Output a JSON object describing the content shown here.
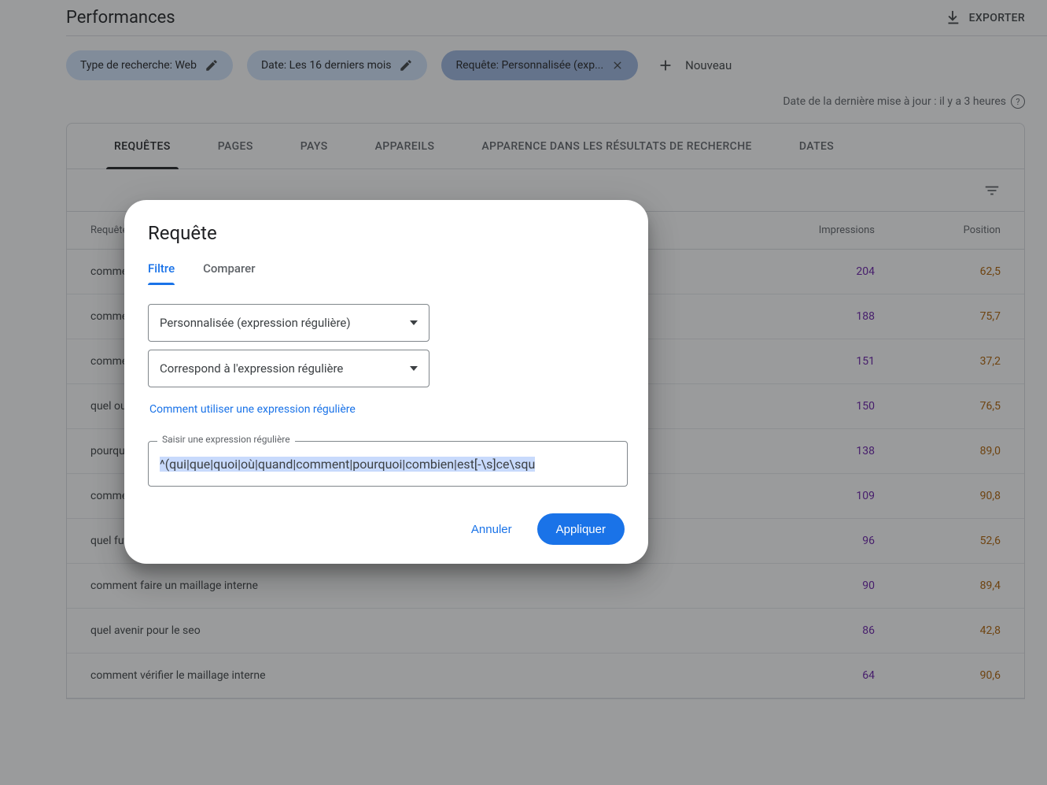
{
  "header": {
    "title": "Performances",
    "export_label": "EXPORTER"
  },
  "chips": {
    "search_type": "Type de recherche: Web",
    "date": "Date: Les 16 derniers mois",
    "query": "Requête: Personnalisée (exp...",
    "new_label": "Nouveau"
  },
  "last_update": "Date de la dernière mise à jour : il y a 3 heures",
  "tabs": {
    "requetes": "REQUÊTES",
    "pages": "PAGES",
    "pays": "PAYS",
    "appareils": "APPAREILS",
    "apparence": "APPARENCE DANS LES RÉSULTATS DE RECHERCHE",
    "dates": "DATES"
  },
  "table": {
    "col_query": "Requêtes",
    "col_impressions": "Impressions",
    "col_position": "Position",
    "rows": [
      {
        "q": "comme",
        "imp": "204",
        "pos": "62,5"
      },
      {
        "q": "comme",
        "imp": "188",
        "pos": "75,7"
      },
      {
        "q": "comme",
        "imp": "151",
        "pos": "37,2"
      },
      {
        "q": "quel ou",
        "imp": "150",
        "pos": "76,5"
      },
      {
        "q": "pourqu",
        "imp": "138",
        "pos": "89,0"
      },
      {
        "q": "comme",
        "imp": "109",
        "pos": "90,8"
      },
      {
        "q": "quel futur pour le seo",
        "imp": "96",
        "pos": "52,6"
      },
      {
        "q": "comment faire un maillage interne",
        "imp": "90",
        "pos": "89,4"
      },
      {
        "q": "quel avenir pour le seo",
        "imp": "86",
        "pos": "42,8"
      },
      {
        "q": "comment vérifier le maillage interne",
        "imp": "64",
        "pos": "90,6"
      }
    ]
  },
  "dialog": {
    "title": "Requête",
    "tab_filter": "Filtre",
    "tab_compare": "Comparer",
    "select_filter_type": "Personnalisée (expression régulière)",
    "select_match_type": "Correspond à l'expression régulière",
    "help_link": "Comment utiliser une expression régulière",
    "field_label": "Saisir une expression régulière",
    "field_value": "^(qui|que|quoi|où|quand|comment|pourquoi|combien|est[-\\s]ce\\squ",
    "cancel": "Annuler",
    "apply": "Appliquer"
  }
}
